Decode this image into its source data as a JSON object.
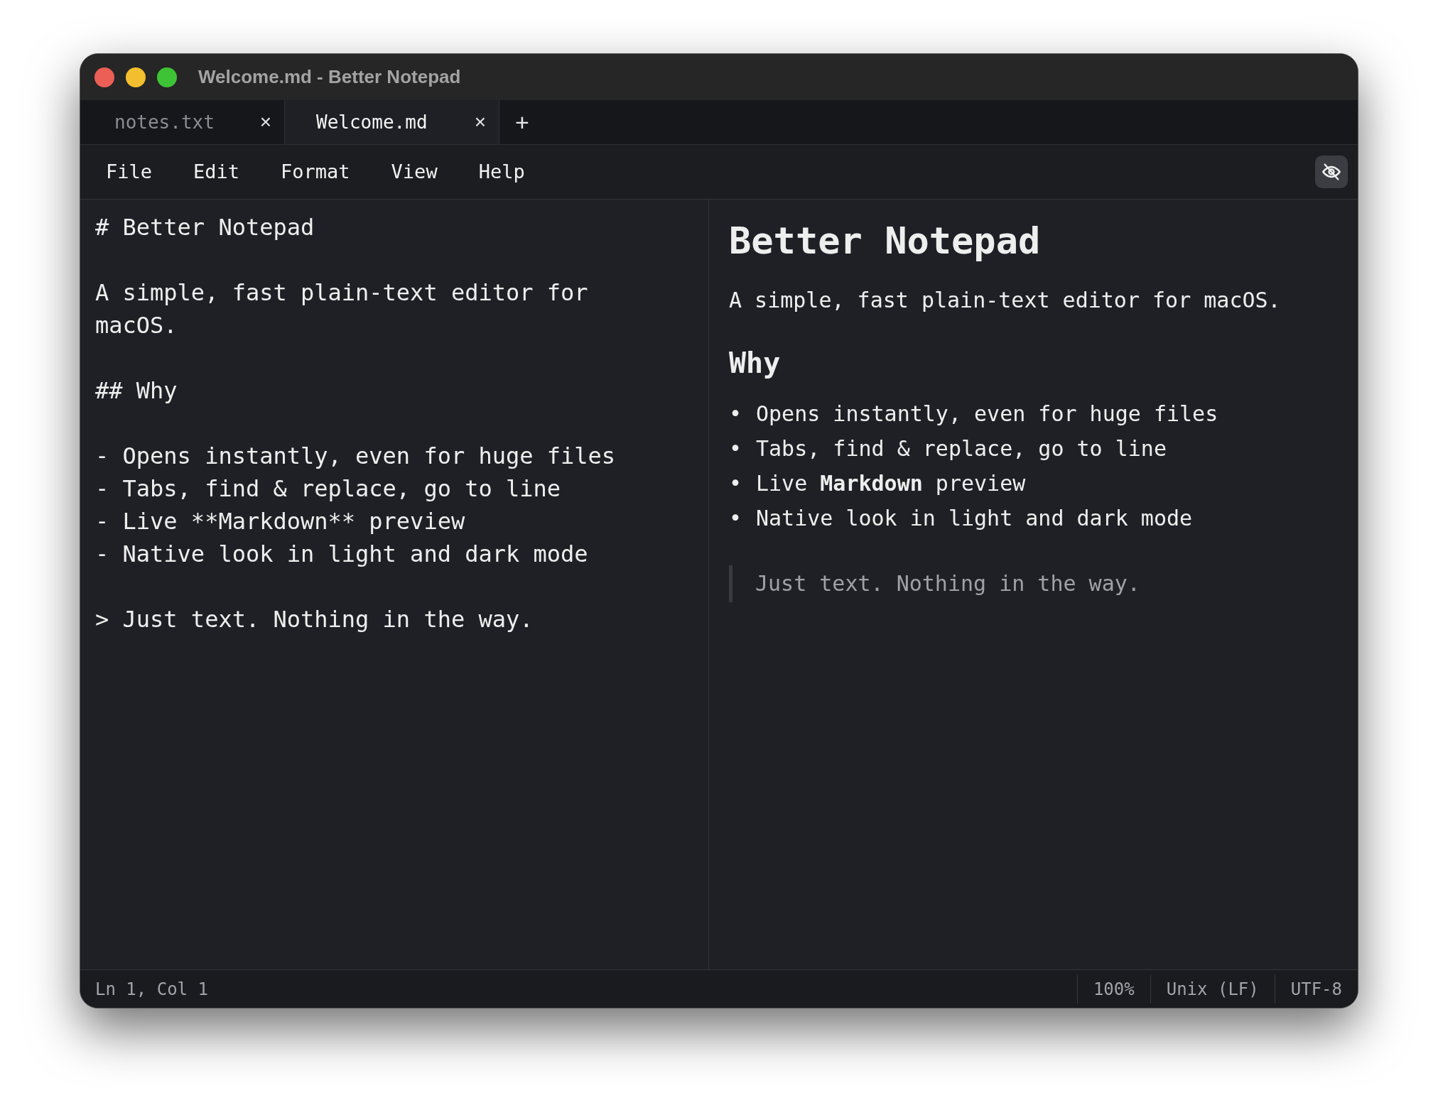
{
  "window": {
    "title": "Welcome.md - Better Notepad"
  },
  "tabs": [
    {
      "label": "notes.txt",
      "close": "×",
      "selected": false
    },
    {
      "label": "Welcome.md",
      "close": "×",
      "selected": true
    }
  ],
  "new_tab": "+",
  "menu": [
    "File",
    "Edit",
    "Format",
    "View",
    "Help"
  ],
  "editor": {
    "blocks": [
      [
        "# Better Notepad"
      ],
      [
        "A simple, fast plain-text editor for macOS."
      ],
      [
        "## Why"
      ],
      [
        "- Opens instantly, even for huge files",
        "- Tabs, find & replace, go to line",
        "- Live **Markdown** preview",
        "- Native look in light and dark mode"
      ],
      [
        "> Just text. Nothing in the way."
      ]
    ]
  },
  "preview": {
    "blocks": [
      {
        "kind": "h1",
        "text": "Better Notepad"
      },
      {
        "kind": "p",
        "text": "A simple, fast plain-text editor for macOS."
      },
      {
        "kind": "h2",
        "text": "Why"
      },
      {
        "kind": "list",
        "bullet": "•",
        "items": [
          "Opens instantly, even for huge files",
          "Tabs, find & replace, go to line",
          "Live **Markdown** preview",
          "Native look in light and dark mode"
        ]
      },
      {
        "kind": "quote",
        "text": "Just text. Nothing in the way."
      }
    ]
  },
  "status_bar": {
    "position": "Ln 1, Col 1",
    "items": [
      "100%",
      "Unix (LF)",
      "UTF-8"
    ]
  }
}
